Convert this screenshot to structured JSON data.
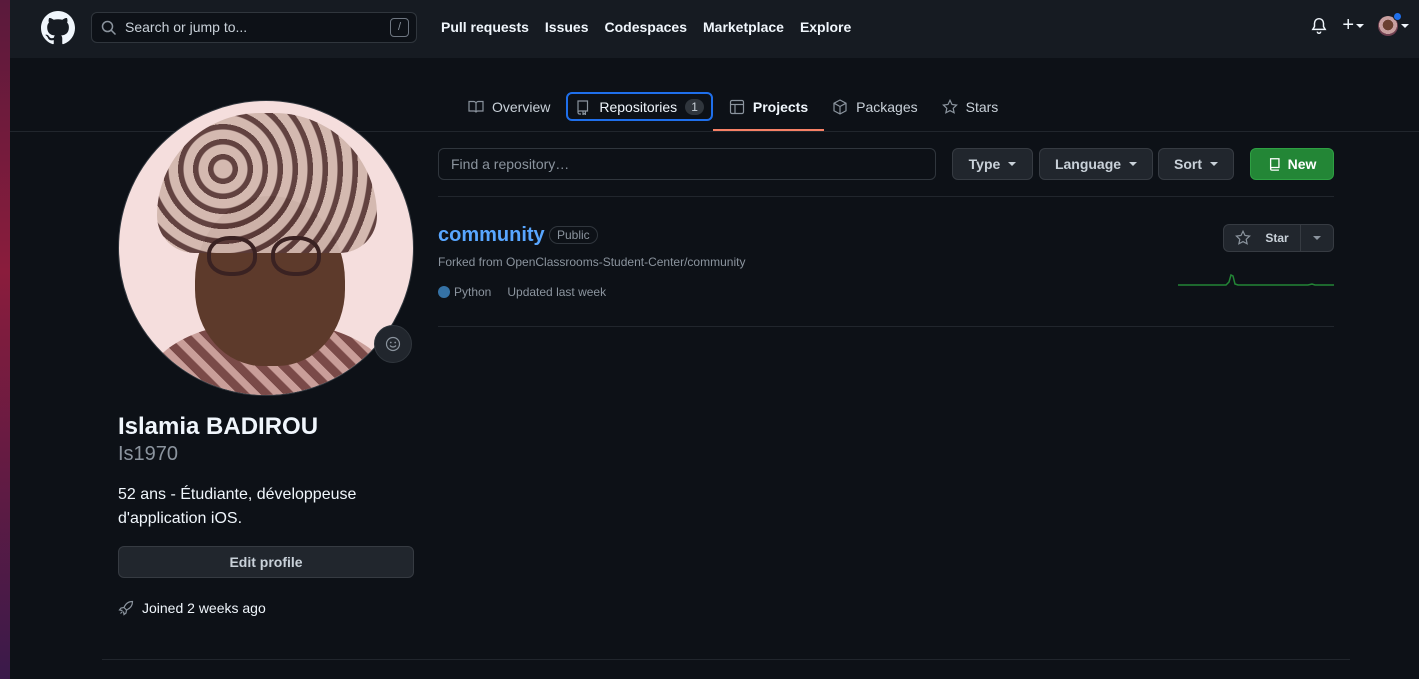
{
  "header": {
    "search_placeholder": "Search or jump to...",
    "search_shortcut": "/",
    "nav": [
      "Pull requests",
      "Issues",
      "Codespaces",
      "Marketplace",
      "Explore"
    ]
  },
  "tabs": [
    {
      "label": "Overview",
      "icon": "book-icon"
    },
    {
      "label": "Repositories",
      "icon": "repo-icon",
      "count": "1"
    },
    {
      "label": "Projects",
      "icon": "table-icon"
    },
    {
      "label": "Packages",
      "icon": "package-icon"
    },
    {
      "label": "Stars",
      "icon": "star-icon"
    }
  ],
  "profile": {
    "full_name": "Islamia BADIROU",
    "username": "Is1970",
    "bio": "52 ans - Étudiante, développeuse d'application iOS.",
    "edit_label": "Edit profile",
    "joined": "Joined 2 weeks ago"
  },
  "repo_filters": {
    "find_placeholder": "Find a repository…",
    "type_label": "Type",
    "language_label": "Language",
    "sort_label": "Sort",
    "new_label": "New"
  },
  "repos": [
    {
      "name": "community",
      "visibility": "Public",
      "forked_from": "Forked from OpenClassrooms-Student-Center/community",
      "language": "Python",
      "language_color": "#3572a5",
      "updated": "Updated last week",
      "star_label": "Star"
    }
  ],
  "colors": {
    "accent": "#58a6ff",
    "new_button": "#238636",
    "active_tab": "#f78166",
    "focus": "#1f6feb"
  }
}
